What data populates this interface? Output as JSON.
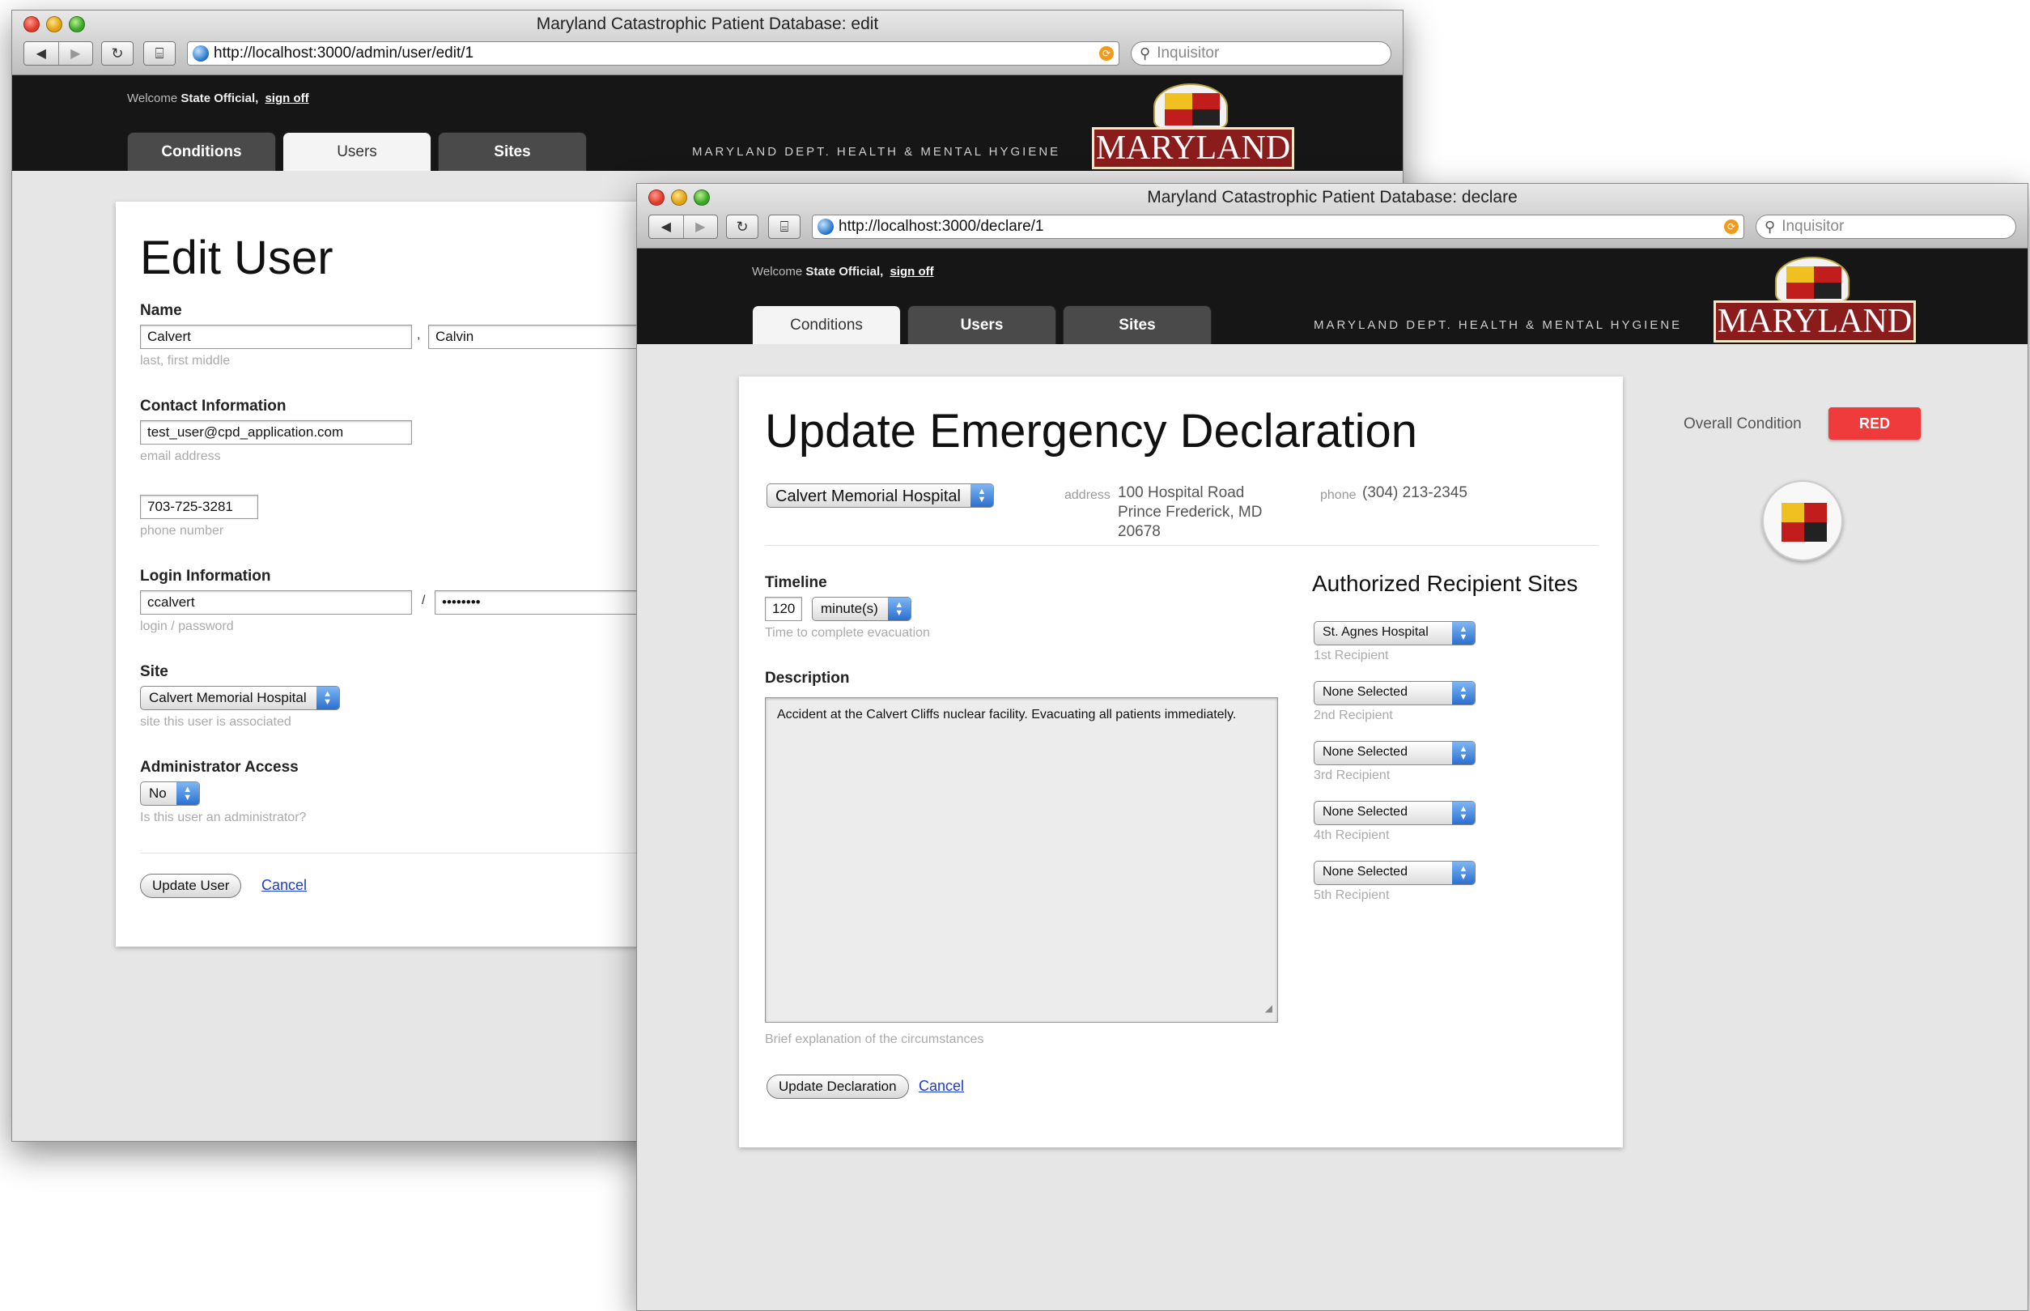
{
  "browser": {
    "nav_back": "◀",
    "nav_forward": "▶",
    "reload": "↻",
    "bookmarks": "⌸",
    "search_placeholder": "Inquisitor"
  },
  "site": {
    "welcome_prefix": "Welcome",
    "user_name": "State Official,",
    "sign_off": "sign off",
    "dept_name": "MARYLAND DEPT. HEALTH & MENTAL HYGIENE",
    "logo_word": "MARYLAND",
    "tabs": [
      "Conditions",
      "Users",
      "Sites"
    ]
  },
  "edit_window": {
    "title": "Maryland Catastrophic Patient Database: edit",
    "url": "http://localhost:3000/admin/user/edit/1",
    "active_tab": "Users",
    "heading": "Edit User",
    "name_label": "Name",
    "last_name": "Calvert",
    "name_separator": ",",
    "first_name": "Calvin",
    "name_hint": "last, first middle",
    "contact_label": "Contact Information",
    "email": "test_user@cpd_application.com",
    "email_hint": "email address",
    "phone": "703-725-3281",
    "phone_hint": "phone number",
    "login_label": "Login Information",
    "login": "ccalvert",
    "login_separator": "/",
    "password": "••••••••",
    "login_hint": "login / password",
    "site_label": "Site",
    "site_value": "Calvert Memorial Hospital",
    "site_hint": "site this user is associated",
    "admin_label": "Administrator Access",
    "admin_value": "No",
    "admin_hint": "Is this user an administrator?",
    "submit": "Update User",
    "cancel": "Cancel"
  },
  "declare_window": {
    "title": "Maryland Catastrophic Patient Database: declare",
    "url": "http://localhost:3000/declare/1",
    "active_tab": "Conditions",
    "heading": "Update Emergency Declaration",
    "hospital": "Calvert Memorial Hospital",
    "address_label": "address",
    "address_lines": [
      "100 Hospital Road",
      "Prince Frederick, MD",
      "20678"
    ],
    "phone_label": "phone",
    "phone": "(304) 213-2345",
    "timeline_label": "Timeline",
    "timeline_value": "120",
    "timeline_unit": "minute(s)",
    "timeline_hint": "Time to complete evacuation",
    "description_label": "Description",
    "description": "Accident at the Calvert Cliffs nuclear facility.  Evacuating all patients immediately.",
    "description_hint": "Brief explanation of the circumstances",
    "submit": "Update Declaration",
    "cancel": "Cancel",
    "recipients_heading": "Authorized Recipient Sites",
    "recipients": [
      {
        "value": "St. Agnes Hospital",
        "label": "1st Recipient"
      },
      {
        "value": "None Selected",
        "label": "2nd Recipient"
      },
      {
        "value": "None Selected",
        "label": "3rd Recipient"
      },
      {
        "value": "None Selected",
        "label": "4th Recipient"
      },
      {
        "value": "None Selected",
        "label": "5th Recipient"
      }
    ],
    "overall_condition_label": "Overall Condition",
    "overall_condition": "RED"
  },
  "colors": {
    "condition_red": "#ef3b3b",
    "header_bg": "#161616",
    "logo_red": "#8b1c1c",
    "link": "#1a3bd4"
  }
}
